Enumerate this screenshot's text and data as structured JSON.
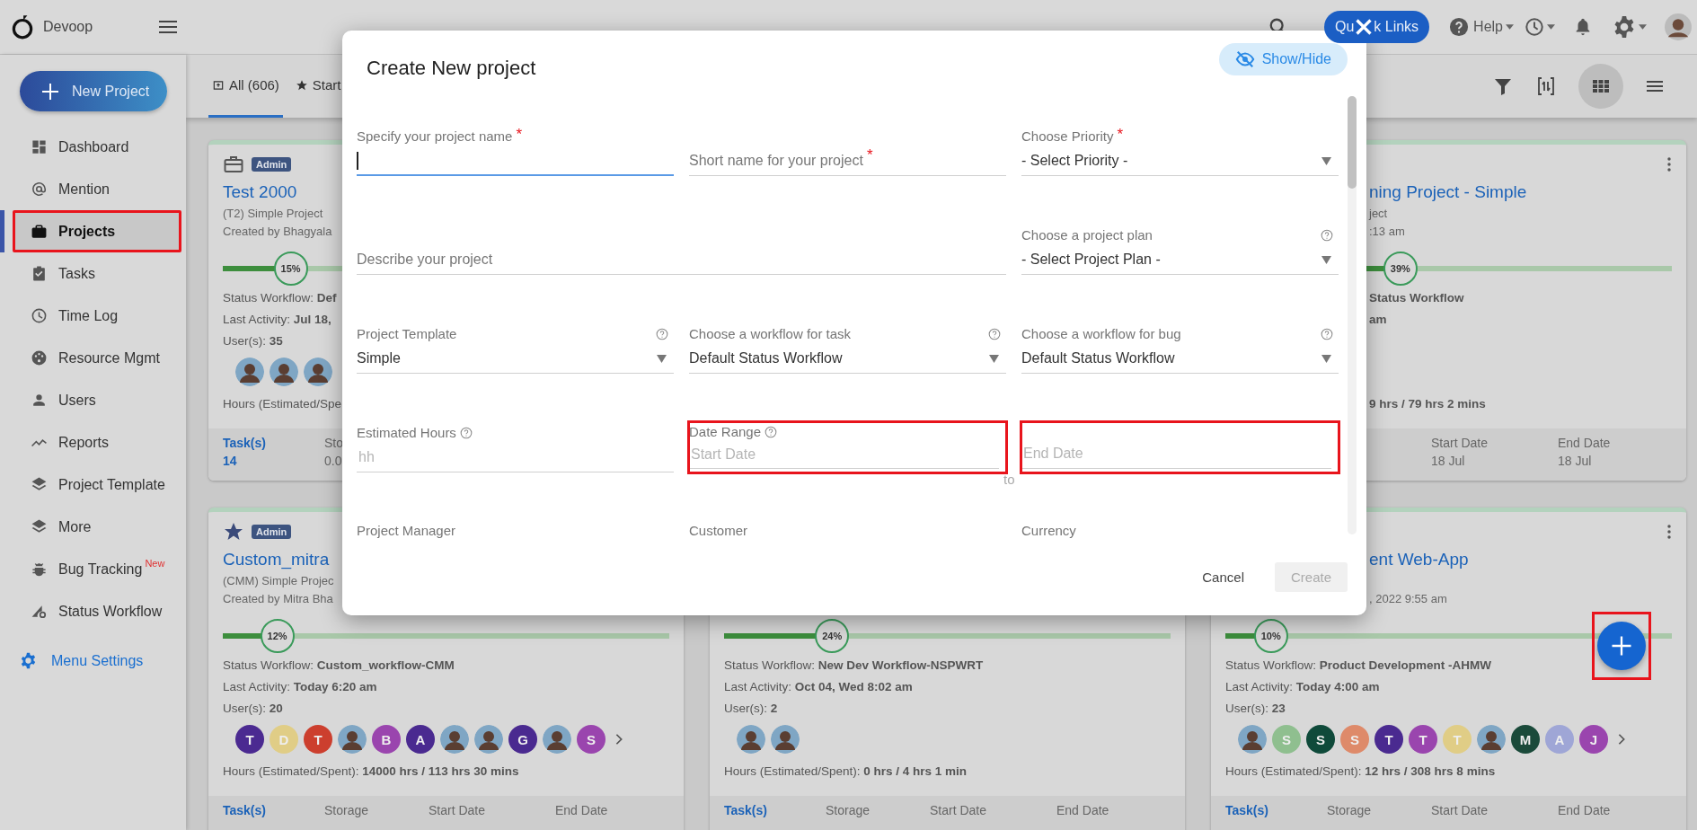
{
  "header": {
    "brand": "Devoop",
    "quick_links": {
      "parts": [
        "Qu",
        "k Links"
      ],
      "crossed": true
    },
    "help": "Help"
  },
  "sidebar": {
    "new_project": "New Project",
    "items": [
      {
        "label": "Dashboard",
        "selected": false,
        "highlighted": false
      },
      {
        "label": "Mention",
        "selected": false,
        "highlighted": false
      },
      {
        "label": "Projects",
        "selected": true,
        "highlighted": true
      },
      {
        "label": "Tasks",
        "selected": false,
        "highlighted": false
      },
      {
        "label": "Time Log",
        "selected": false,
        "highlighted": false
      },
      {
        "label": "Resource Mgmt",
        "selected": false,
        "highlighted": false
      },
      {
        "label": "Users",
        "selected": false,
        "highlighted": false
      },
      {
        "label": "Reports",
        "selected": false,
        "highlighted": false
      },
      {
        "label": "Project Template",
        "selected": false,
        "highlighted": false
      },
      {
        "label": "More",
        "selected": false,
        "highlighted": false
      },
      {
        "label": "Bug Tracking",
        "badge": "New",
        "selected": false,
        "highlighted": false
      },
      {
        "label": "Status Workflow",
        "selected": false,
        "highlighted": false
      }
    ],
    "menu_settings": "Menu Settings"
  },
  "toolbar": {
    "tabs": [
      {
        "label": "All (606)",
        "selected": true
      },
      {
        "label": "Start",
        "selected": false
      }
    ],
    "views": [
      {
        "selected": true
      },
      {
        "selected": false
      }
    ]
  },
  "cards": [
    {
      "starred": false,
      "badge": "Admin",
      "title": "Test 2000",
      "subtitle": "(T2) Simple Project",
      "created": "Created by Bhagyala",
      "progress": {
        "level": 0.15,
        "label": "15%"
      },
      "stats": [
        {
          "label": "Status Workflow:",
          "value": "Def"
        },
        {
          "label": "Last Activity:",
          "value": "Jul 18,"
        },
        {
          "label": "User(s):",
          "value": "35"
        }
      ],
      "users": [
        {
          "kind": "photo"
        },
        {
          "kind": "photo"
        },
        {
          "kind": "photo"
        }
      ],
      "hours": {
        "label": "Hours (Estimated/Spe"
      },
      "footer": [
        {
          "label": "Task(s)",
          "value": "14",
          "kind": "link"
        },
        {
          "label": "Sto",
          "value": "0.0",
          "kind": "plain"
        }
      ]
    },
    {
      "menu": true,
      "title": "ning Project - Simple",
      "subtitle": "ject",
      "created": ":13 am",
      "progress": {
        "level": 0.39,
        "label": "39%"
      },
      "stats": [
        {
          "value": "Status Workflow"
        },
        {
          "value": "am"
        }
      ],
      "hours": {
        "value": "9 hrs / 79 hrs 2 mins"
      },
      "footer": [
        {
          "label": "Start Date",
          "value": "18 Jul",
          "kind": "plain"
        },
        {
          "label": "End Date",
          "value": "18 Jul",
          "kind": "plain"
        }
      ]
    },
    {
      "starred": true,
      "badge": "Admin",
      "title": "Custom_mitra",
      "subtitle": "(CMM) Simple Projec",
      "created": "Created by Mitra Bha",
      "progress": {
        "level": 0.12,
        "label": "12%"
      },
      "stats": [
        {
          "label": "Status Workflow:",
          "value": "Custom_workflow-CMM"
        },
        {
          "label": "Last Activity:",
          "value": "Today 6:20 am"
        },
        {
          "label": "User(s):",
          "value": "20"
        }
      ],
      "users": [
        {
          "kind": "letter",
          "letter": "T",
          "color": "#4b2a91"
        },
        {
          "kind": "letter",
          "letter": "D",
          "color": "#e0cd86"
        },
        {
          "kind": "letter",
          "letter": "T",
          "color": "#cc3f2e"
        },
        {
          "kind": "photo"
        },
        {
          "kind": "letter",
          "letter": "B",
          "color": "#9a45ae"
        },
        {
          "kind": "letter",
          "letter": "A",
          "color": "#4a2a90"
        },
        {
          "kind": "photo"
        },
        {
          "kind": "photo"
        },
        {
          "kind": "letter",
          "letter": "G",
          "color": "#4a2a90"
        },
        {
          "kind": "photo"
        },
        {
          "kind": "letter",
          "letter": "S",
          "color": "#9a45ae"
        }
      ],
      "more_users": true,
      "hours": {
        "label": "Hours (Estimated/Spent):",
        "value": "14000 hrs / 113 hrs 30 mins"
      },
      "footer": [
        {
          "label": "Task(s)",
          "kind": "link"
        },
        {
          "label": "Storage",
          "kind": "plain"
        },
        {
          "label": "Start Date",
          "kind": "plain"
        },
        {
          "label": "End Date",
          "kind": "plain"
        }
      ]
    },
    {
      "progress": {
        "level": 0.24,
        "label": "24%"
      },
      "stats": [
        {
          "label": "Status Workflow:",
          "value": "New Dev Workflow-NSPWRT"
        },
        {
          "label": "Last Activity:",
          "value": "Oct 04, Wed 8:02 am"
        },
        {
          "label": "User(s):",
          "value": "2"
        }
      ],
      "users": [
        {
          "kind": "photo"
        },
        {
          "kind": "photo"
        }
      ],
      "hours": {
        "label": "Hours (Estimated/Spent):",
        "value": "0 hrs / 4 hrs 1 min"
      },
      "footer": [
        {
          "label": "Task(s)",
          "kind": "link"
        },
        {
          "label": "Storage",
          "kind": "plain"
        },
        {
          "label": "Start Date",
          "kind": "plain"
        },
        {
          "label": "End Date",
          "kind": "plain"
        }
      ]
    },
    {
      "menu": true,
      "title": "ent Web-App",
      "created": ", 2022 9:55 am",
      "progress": {
        "level": 0.1,
        "label": "10%"
      },
      "stats": [
        {
          "label": "Status Workflow:",
          "value": "Product Development -AHMW"
        },
        {
          "label": "Last Activity:",
          "value": "Today 4:00 am"
        },
        {
          "label": "User(s):",
          "value": "23"
        }
      ],
      "users": [
        {
          "kind": "photo"
        },
        {
          "kind": "letter",
          "letter": "S",
          "color": "#8fbf8f"
        },
        {
          "kind": "letter",
          "letter": "S",
          "color": "#0f4a3a"
        },
        {
          "kind": "letter",
          "letter": "S",
          "color": "#de8a6a"
        },
        {
          "kind": "letter",
          "letter": "T",
          "color": "#4a2a90"
        },
        {
          "kind": "letter",
          "letter": "T",
          "color": "#9a45ae"
        },
        {
          "kind": "letter",
          "letter": "T",
          "color": "#e0cd86"
        },
        {
          "kind": "photo"
        },
        {
          "kind": "letter",
          "letter": "M",
          "color": "#1a4a3a"
        },
        {
          "kind": "letter",
          "letter": "A",
          "color": "#9fa6d6"
        },
        {
          "kind": "letter",
          "letter": "J",
          "color": "#9a45ae"
        }
      ],
      "more_users": true,
      "hours": {
        "label": "Hours (Estimated/Spent):",
        "value": "12 hrs / 308 hrs 8 mins"
      },
      "footer": [
        {
          "label": "Task(s)",
          "kind": "link"
        },
        {
          "label": "Storage",
          "kind": "plain"
        },
        {
          "label": "Start Date",
          "kind": "plain"
        },
        {
          "label": "End Date",
          "kind": "plain"
        }
      ]
    }
  ],
  "fab": {
    "highlighted": true
  },
  "modal": {
    "title": "Create New project",
    "show_hide": "Show/Hide",
    "rows": [
      [
        {
          "kind": "text",
          "label": "Specify your project name",
          "required": "*",
          "focused": true
        },
        {
          "kind": "text",
          "placeholder": "Short name for your project",
          "required": "*"
        },
        {
          "kind": "select",
          "label": "Choose Priority",
          "required": "*",
          "value": "- Select Priority -"
        }
      ],
      [
        {
          "kind": "textarea",
          "placeholder": "Describe your project",
          "colspan": 2
        },
        {
          "kind": "select",
          "label": "Choose a project plan",
          "help": true,
          "value": "- Select Project Plan -"
        }
      ],
      [
        {
          "kind": "select",
          "label": "Project Template",
          "help": true,
          "value": "Simple"
        },
        {
          "kind": "select",
          "label": "Choose a workflow for task",
          "help": true,
          "value": "Default Status Workflow"
        },
        {
          "kind": "select",
          "label": "Choose a workflow for bug",
          "help": true,
          "value": "Default Status Workflow"
        }
      ],
      [
        {
          "kind": "text",
          "label": "Estimated Hours",
          "help": true,
          "placeholder": "hh"
        },
        {
          "kind": "text",
          "label": "Date Range",
          "help": true,
          "placeholder": "Start Date",
          "highlighted": true
        },
        {
          "kind": "text",
          "placeholder": "End Date",
          "joiner": "to",
          "highlighted": true
        }
      ],
      [
        {
          "kind": "heading",
          "label": "Project Manager"
        },
        {
          "kind": "heading",
          "label": "Customer"
        },
        {
          "kind": "heading",
          "label": "Currency"
        }
      ]
    ],
    "cancel": "Cancel",
    "create": {
      "label": "Create",
      "disabled": true
    }
  }
}
